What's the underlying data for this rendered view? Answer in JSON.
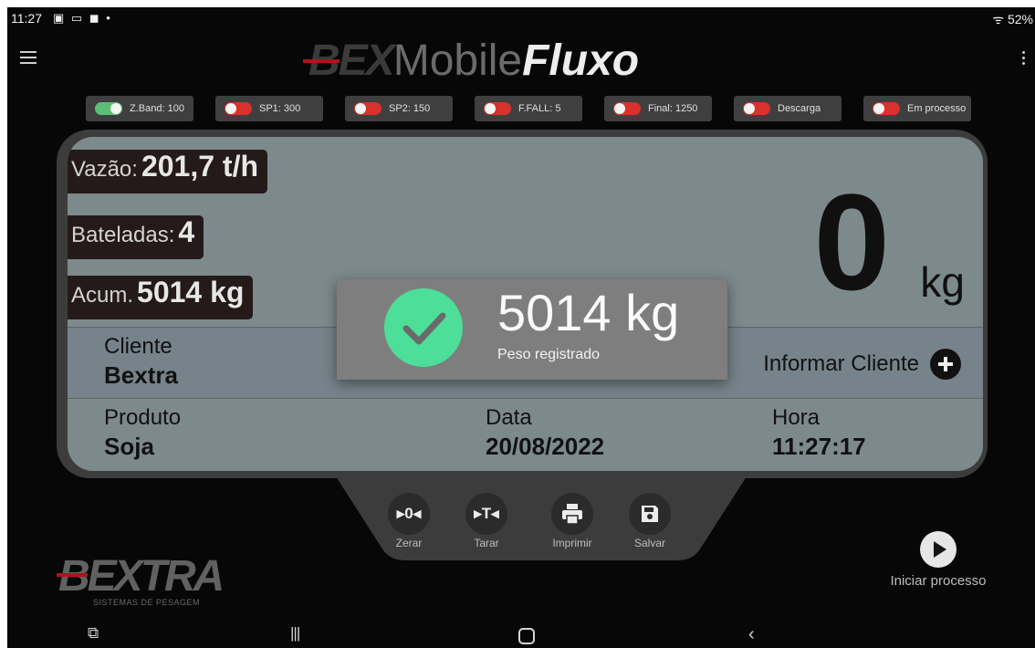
{
  "status_bar": {
    "time": "11:27",
    "battery": "52%"
  },
  "app_bar": {
    "title_part1": "BEX",
    "title_part2": "Mobile",
    "title_part3": "Fluxo"
  },
  "chips": [
    {
      "label": "Z.Band: 100",
      "state": "on"
    },
    {
      "label": "SP1: 300",
      "state": "off"
    },
    {
      "label": "SP2: 150",
      "state": "off"
    },
    {
      "label": "F.FALL: 5",
      "state": "off"
    },
    {
      "label": "Final: 1250",
      "state": "off"
    },
    {
      "label": "Descarga",
      "state": "off"
    },
    {
      "label": "Em processo",
      "state": "off"
    }
  ],
  "metrics": {
    "flow_label": "Vazão:",
    "flow_value": "201,7 t/h",
    "batches_label": "Bateladas:",
    "batches_value": "4",
    "accum_label": "Acum.",
    "accum_value": "5014 kg"
  },
  "weight": {
    "value": "0",
    "unit": "kg"
  },
  "client": {
    "label": "Cliente",
    "value": "Bextra",
    "action": "Informar Cliente"
  },
  "product": {
    "label": "Produto",
    "value": "Soja"
  },
  "date": {
    "label": "Data",
    "value": "20/08/2022"
  },
  "time": {
    "label": "Hora",
    "value": "11:27:17"
  },
  "toast": {
    "weight": "5014 kg",
    "message": "Peso registrado"
  },
  "controls": {
    "zero": "Zerar",
    "tare": "Tarar",
    "print": "Imprimir",
    "save": "Salvar"
  },
  "brand": {
    "logo": "BEXTRA",
    "tagline": "SISTEMAS DE PESAGEM"
  },
  "start_process": {
    "label": "Iniciar processo"
  },
  "colors": {
    "accent_green": "#4dde9a",
    "toggle_on": "#5bbf73",
    "toggle_off": "#d9322c",
    "brand_red": "#b3121b"
  }
}
